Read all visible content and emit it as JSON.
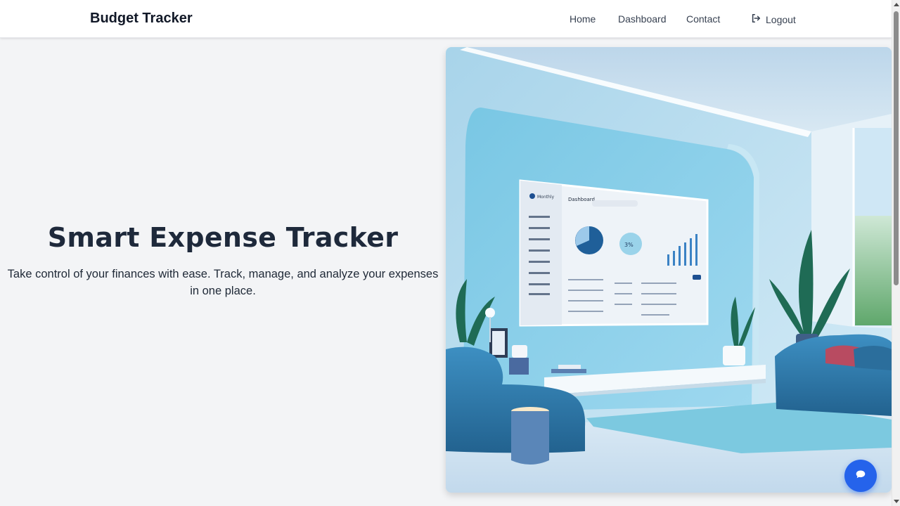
{
  "nav": {
    "brand": "Budget Tracker",
    "links": [
      {
        "label": "Home"
      },
      {
        "label": "Dashboard"
      },
      {
        "label": "Contact"
      }
    ],
    "logout_label": "Logout"
  },
  "hero": {
    "title": "Smart Expense Tracker",
    "subtitle": "Take control of your finances with ease. Track, manage, and analyze your expenses in one place.",
    "illustration": {
      "screen_title": "Dashboard",
      "screen_app": "Monthly",
      "gauge_text": "3%"
    }
  },
  "chat": {
    "icon": "chat-bubble-icon"
  },
  "colors": {
    "brand_text": "#111827",
    "accent": "#2563eb",
    "background": "#f3f4f6",
    "title": "#1e293b"
  }
}
